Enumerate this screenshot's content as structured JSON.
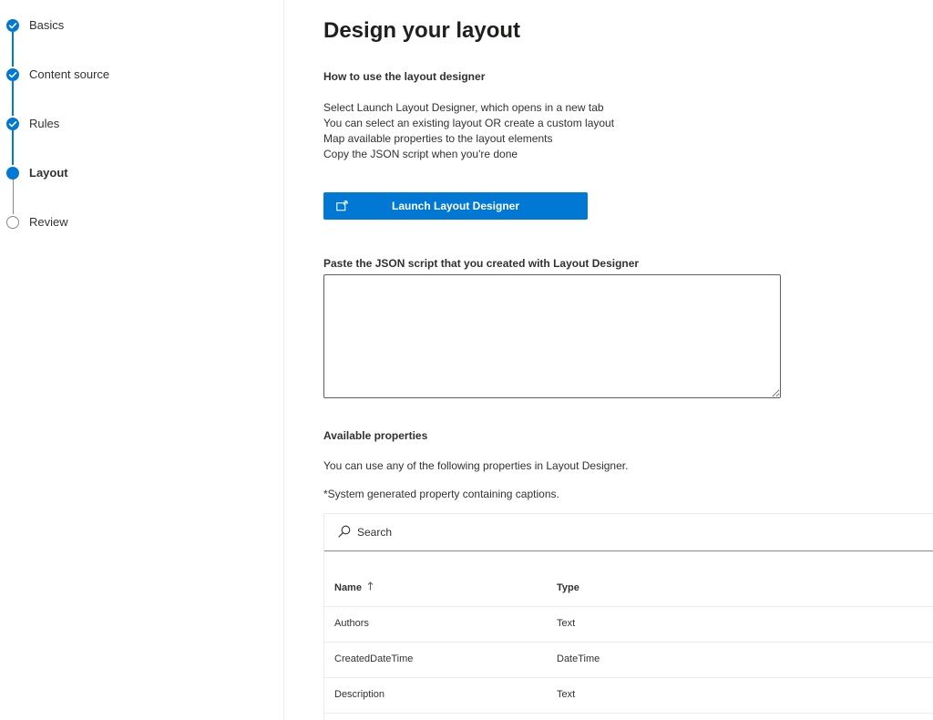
{
  "steps": [
    {
      "label": "Basics",
      "state": "done"
    },
    {
      "label": "Content source",
      "state": "done"
    },
    {
      "label": "Rules",
      "state": "done"
    },
    {
      "label": "Layout",
      "state": "current"
    },
    {
      "label": "Review",
      "state": "todo"
    }
  ],
  "main": {
    "title": "Design your layout",
    "howto_heading": "How to use the layout designer",
    "instructions": [
      "Select Launch Layout Designer, which opens in a new tab",
      "You can select an existing layout OR create a custom layout",
      "Map available properties to the layout elements",
      "Copy the JSON script when you're done"
    ],
    "launch_button_label": "Launch Layout Designer",
    "launch_button_icon": "open-in-new-window-icon",
    "json_label": "Paste the JSON script that you created with Layout Designer",
    "json_value": "",
    "available_heading": "Available properties",
    "available_desc": "You can use any of the following properties in Layout Designer.",
    "system_note": "*System generated property containing captions."
  },
  "properties": {
    "search_placeholder": "Search",
    "columns": {
      "name": "Name",
      "type": "Type",
      "sort": "ascending"
    },
    "rows": [
      {
        "name": "Authors",
        "type": "Text"
      },
      {
        "name": "CreatedDateTime",
        "type": "DateTime"
      },
      {
        "name": "Description",
        "type": "Text"
      }
    ]
  },
  "colors": {
    "accent": "#0078d4",
    "pending": "#8a8886",
    "divider": "#edebe9"
  }
}
